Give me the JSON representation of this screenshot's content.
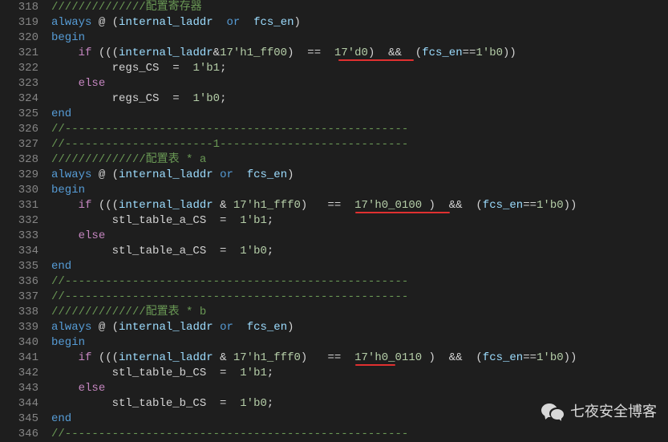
{
  "lines": [
    {
      "num": 318,
      "tokens": [
        [
          "//////////////",
          "comment"
        ],
        [
          "配置寄存器",
          "comment"
        ]
      ]
    },
    {
      "num": 319,
      "tokens": [
        [
          "always",
          "kw-blue"
        ],
        [
          " @ ",
          "op"
        ],
        [
          "(",
          "paren"
        ],
        [
          "internal_laddr  ",
          "ident"
        ],
        [
          "or",
          "kw-blue"
        ],
        [
          "  fcs_en",
          "ident"
        ],
        [
          ")",
          "paren"
        ]
      ]
    },
    {
      "num": 320,
      "tokens": [
        [
          "begin",
          "kw-blue"
        ]
      ]
    },
    {
      "num": 321,
      "tokens": [
        [
          "    ",
          "op"
        ],
        [
          "if",
          "keyword"
        ],
        [
          " (((",
          "paren"
        ],
        [
          "internal_laddr",
          "ident"
        ],
        [
          "&",
          "op"
        ],
        [
          "17'h1_ff00",
          "number"
        ],
        [
          ")  ",
          "paren"
        ],
        [
          "==",
          "op"
        ],
        [
          "  ",
          "op"
        ],
        [
          "17'd0",
          "number"
        ],
        [
          ")  ",
          "paren"
        ],
        [
          "&&",
          "op"
        ],
        [
          "  (",
          "paren"
        ],
        [
          "fcs_en",
          "ident"
        ],
        [
          "==",
          "op"
        ],
        [
          "1'b0",
          "number"
        ],
        [
          "))",
          "paren"
        ]
      ]
    },
    {
      "num": 322,
      "tokens": [
        [
          "         regs_CS  ",
          "op"
        ],
        [
          "=",
          "op"
        ],
        [
          "  ",
          "op"
        ],
        [
          "1'b1",
          "number"
        ],
        [
          ";",
          "op"
        ]
      ]
    },
    {
      "num": 323,
      "tokens": [
        [
          "    ",
          "op"
        ],
        [
          "else",
          "keyword"
        ]
      ]
    },
    {
      "num": 324,
      "tokens": [
        [
          "         regs_CS  ",
          "op"
        ],
        [
          "=",
          "op"
        ],
        [
          "  ",
          "op"
        ],
        [
          "1'b0",
          "number"
        ],
        [
          ";",
          "op"
        ]
      ]
    },
    {
      "num": 325,
      "tokens": [
        [
          "end",
          "kw-blue"
        ]
      ]
    },
    {
      "num": 326,
      "tokens": [
        [
          "//---------------------------------------------------",
          "comment"
        ]
      ]
    },
    {
      "num": 327,
      "tokens": [
        [
          "//----------------------1----------------------------",
          "comment"
        ]
      ]
    },
    {
      "num": 328,
      "tokens": [
        [
          "//////////////",
          "comment"
        ],
        [
          "配置表 * a",
          "comment"
        ]
      ]
    },
    {
      "num": 329,
      "tokens": [
        [
          "always",
          "kw-blue"
        ],
        [
          " @ ",
          "op"
        ],
        [
          "(",
          "paren"
        ],
        [
          "internal_laddr ",
          "ident"
        ],
        [
          "or",
          "kw-blue"
        ],
        [
          "  fcs_en",
          "ident"
        ],
        [
          ")",
          "paren"
        ]
      ]
    },
    {
      "num": 330,
      "tokens": [
        [
          "begin",
          "kw-blue"
        ]
      ]
    },
    {
      "num": 331,
      "tokens": [
        [
          "    ",
          "op"
        ],
        [
          "if",
          "keyword"
        ],
        [
          " (((",
          "paren"
        ],
        [
          "internal_laddr ",
          "ident"
        ],
        [
          "&",
          "op"
        ],
        [
          " 17'h1_fff0",
          "number"
        ],
        [
          ")   ",
          "paren"
        ],
        [
          "==",
          "op"
        ],
        [
          "  ",
          "op"
        ],
        [
          "17'h0_0100 ",
          "number"
        ],
        [
          ")  ",
          "paren"
        ],
        [
          "&&",
          "op"
        ],
        [
          "  (",
          "paren"
        ],
        [
          "fcs_en",
          "ident"
        ],
        [
          "==",
          "op"
        ],
        [
          "1'b0",
          "number"
        ],
        [
          "))",
          "paren"
        ]
      ]
    },
    {
      "num": 332,
      "tokens": [
        [
          "         stl_table_a_CS  ",
          "op"
        ],
        [
          "=",
          "op"
        ],
        [
          "  ",
          "op"
        ],
        [
          "1'b1",
          "number"
        ],
        [
          ";",
          "op"
        ]
      ]
    },
    {
      "num": 333,
      "tokens": [
        [
          "    ",
          "op"
        ],
        [
          "else",
          "keyword"
        ]
      ]
    },
    {
      "num": 334,
      "tokens": [
        [
          "         stl_table_a_CS  ",
          "op"
        ],
        [
          "=",
          "op"
        ],
        [
          "  ",
          "op"
        ],
        [
          "1'b0",
          "number"
        ],
        [
          ";",
          "op"
        ]
      ]
    },
    {
      "num": 335,
      "tokens": [
        [
          "end",
          "kw-blue"
        ]
      ]
    },
    {
      "num": 336,
      "tokens": [
        [
          "//---------------------------------------------------",
          "comment"
        ]
      ]
    },
    {
      "num": 337,
      "tokens": [
        [
          "//---------------------------------------------------",
          "comment"
        ]
      ]
    },
    {
      "num": 338,
      "tokens": [
        [
          "//////////////",
          "comment"
        ],
        [
          "配置表 * b",
          "comment"
        ]
      ]
    },
    {
      "num": 339,
      "tokens": [
        [
          "always",
          "kw-blue"
        ],
        [
          " @ ",
          "op"
        ],
        [
          "(",
          "paren"
        ],
        [
          "internal_laddr ",
          "ident"
        ],
        [
          "or",
          "kw-blue"
        ],
        [
          "  fcs_en",
          "ident"
        ],
        [
          ")",
          "paren"
        ]
      ]
    },
    {
      "num": 340,
      "tokens": [
        [
          "begin",
          "kw-blue"
        ]
      ]
    },
    {
      "num": 341,
      "tokens": [
        [
          "    ",
          "op"
        ],
        [
          "if",
          "keyword"
        ],
        [
          " (((",
          "paren"
        ],
        [
          "internal_laddr ",
          "ident"
        ],
        [
          "&",
          "op"
        ],
        [
          " 17'h1_fff0",
          "number"
        ],
        [
          ")   ",
          "paren"
        ],
        [
          "==",
          "op"
        ],
        [
          "  ",
          "op"
        ],
        [
          "17'h0_0110 ",
          "number"
        ],
        [
          ")  ",
          "paren"
        ],
        [
          "&&",
          "op"
        ],
        [
          "  (",
          "paren"
        ],
        [
          "fcs_en",
          "ident"
        ],
        [
          "==",
          "op"
        ],
        [
          "1'b0",
          "number"
        ],
        [
          "))",
          "paren"
        ]
      ]
    },
    {
      "num": 342,
      "tokens": [
        [
          "         stl_table_b_CS  ",
          "op"
        ],
        [
          "=",
          "op"
        ],
        [
          "  ",
          "op"
        ],
        [
          "1'b1",
          "number"
        ],
        [
          ";",
          "op"
        ]
      ]
    },
    {
      "num": 343,
      "tokens": [
        [
          "    ",
          "op"
        ],
        [
          "else",
          "keyword"
        ]
      ]
    },
    {
      "num": 344,
      "tokens": [
        [
          "         stl_table_b_CS  ",
          "op"
        ],
        [
          "=",
          "op"
        ],
        [
          "  ",
          "op"
        ],
        [
          "1'b0",
          "number"
        ],
        [
          ";",
          "op"
        ]
      ]
    },
    {
      "num": 345,
      "tokens": [
        [
          "end",
          "kw-blue"
        ]
      ]
    },
    {
      "num": 346,
      "tokens": [
        [
          "//---------------------------------------------------",
          "comment"
        ]
      ]
    }
  ],
  "watermark": "七夜安全博客"
}
